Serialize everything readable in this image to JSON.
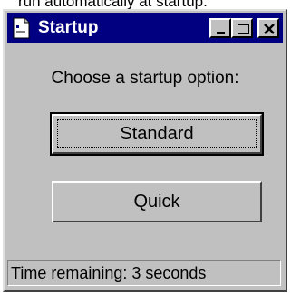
{
  "background_caption": "run automatically at startup.",
  "window": {
    "title": "Startup",
    "controls": {
      "minimize_icon": "minimize-icon",
      "maximize_icon": "maximize-icon",
      "close_icon": "close-icon"
    }
  },
  "prompt": "Choose a startup option:",
  "buttons": {
    "standard": "Standard",
    "quick": "Quick"
  },
  "status": "Time remaining: 3 seconds",
  "colors": {
    "titlebar": "#000080",
    "face": "#c0c0c0"
  }
}
